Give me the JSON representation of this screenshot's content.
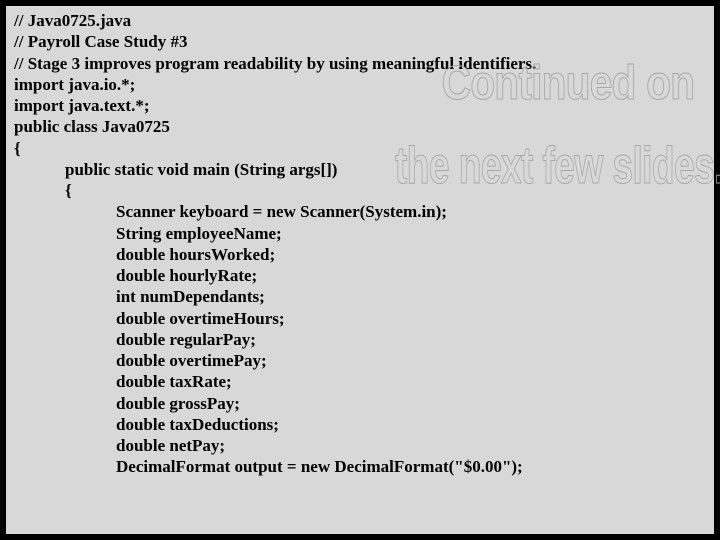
{
  "code": {
    "l1": "// Java0725.java",
    "l2": "// Payroll Case Study #3",
    "l3": "// Stage 3 improves program readability by using meaningful identifiers.",
    "l4": "",
    "l5": "import java.io.*;",
    "l6": "import java.text.*;",
    "l7": "",
    "l8": "public class Java0725",
    "l9": "{",
    "l10": "            public static void main (String args[])",
    "l11": "            {",
    "l12": "                        Scanner keyboard = new Scanner(System.in);",
    "l13": "                        String employeeName;",
    "l14": "                        double hoursWorked;",
    "l15": "                        double hourlyRate;",
    "l16": "                        int numDependants;",
    "l17": "                        double overtimeHours;",
    "l18": "                        double regularPay;",
    "l19": "                        double overtimePay;",
    "l20": "                        double taxRate;",
    "l21": "                        double grossPay;",
    "l22": "                        double taxDeductions;",
    "l23": "                        double netPay;",
    "l24": "",
    "l25": "                        DecimalFormat output = new DecimalFormat(\"$0.00\");"
  },
  "watermark": {
    "line1": "Continued on",
    "line2": "the next few slides."
  }
}
